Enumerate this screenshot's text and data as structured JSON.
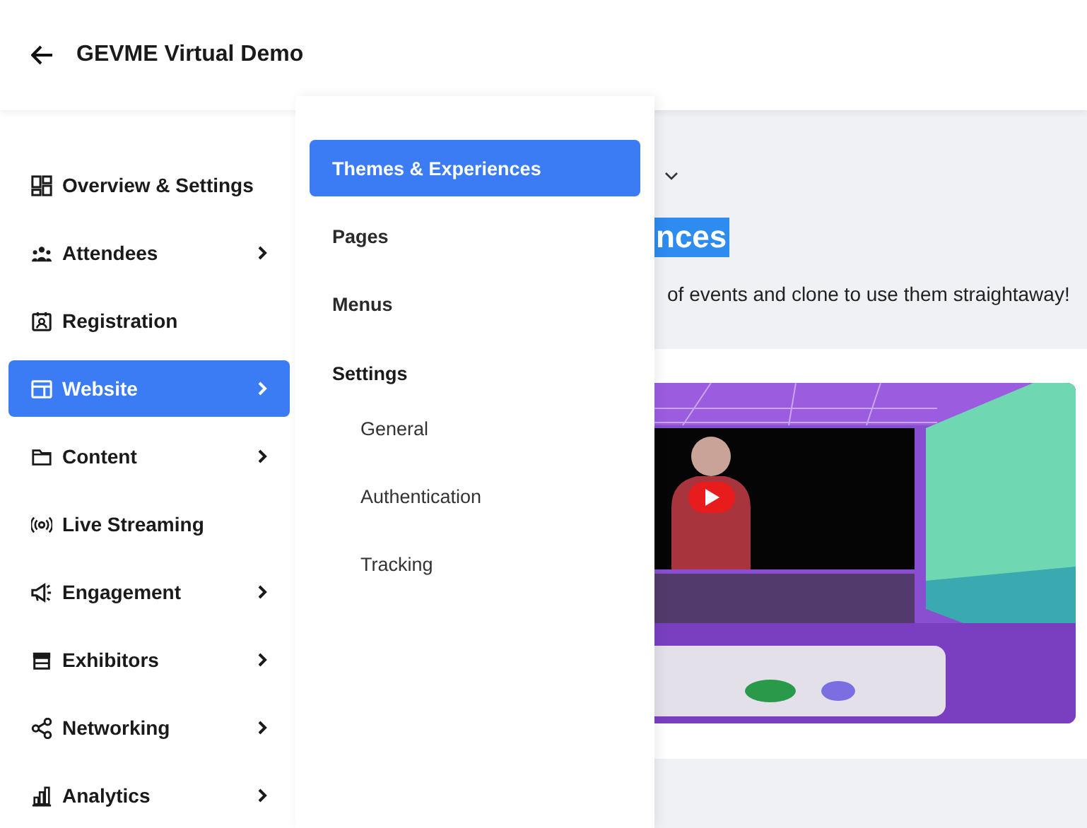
{
  "header": {
    "title": "GEVME Virtual Demo"
  },
  "sidebar": {
    "items": [
      {
        "label": "Overview & Settings",
        "expandable": false,
        "selected": false
      },
      {
        "label": "Attendees",
        "expandable": true,
        "selected": false
      },
      {
        "label": "Registration",
        "expandable": false,
        "selected": false
      },
      {
        "label": "Website",
        "expandable": true,
        "selected": true
      },
      {
        "label": "Content",
        "expandable": true,
        "selected": false
      },
      {
        "label": "Live Streaming",
        "expandable": false,
        "selected": false
      },
      {
        "label": "Engagement",
        "expandable": true,
        "selected": false
      },
      {
        "label": "Exhibitors",
        "expandable": true,
        "selected": false
      },
      {
        "label": "Networking",
        "expandable": true,
        "selected": false
      },
      {
        "label": "Analytics",
        "expandable": true,
        "selected": false
      }
    ]
  },
  "submenu": {
    "items": [
      {
        "label": "Themes & Experiences",
        "kind": "item",
        "selected": true
      },
      {
        "label": "Pages",
        "kind": "item",
        "selected": false
      },
      {
        "label": "Menus",
        "kind": "item",
        "selected": false
      },
      {
        "label": "Settings",
        "kind": "heading"
      },
      {
        "label": "General",
        "kind": "subitem",
        "selected": false
      },
      {
        "label": "Authentication",
        "kind": "subitem",
        "selected": false
      },
      {
        "label": "Tracking",
        "kind": "subitem",
        "selected": false
      }
    ]
  },
  "main": {
    "heading": "nces",
    "description": "of events and clone to use them straightaway!"
  }
}
